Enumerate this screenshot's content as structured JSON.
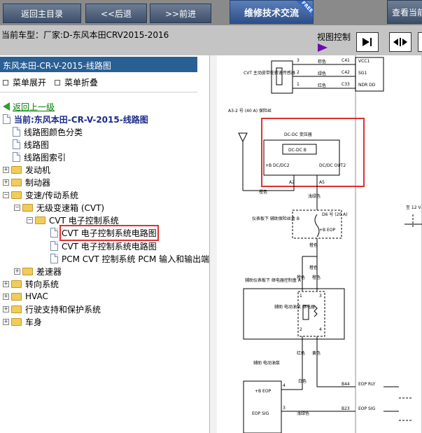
{
  "toolbar": {
    "home_label": "返回主目录",
    "back_label": "<<后退",
    "forward_label": ">>前进",
    "repair_label": "维修技术交流",
    "free_badge": "FREE",
    "view_current_label": "查看当前"
  },
  "infobar": {
    "current_model": "当前车型：厂家:D-东风本田CRV2015-2016",
    "view_control_label": "视图控制"
  },
  "tree": {
    "panel_title": "东风本田-CR-V-2015-线路图",
    "expand_label": "菜单展开",
    "collapse_label": "菜单折叠",
    "up_level": "返回上一级",
    "current": "当前:东风本田-CR-V-2015-线路图",
    "items": [
      "线路图颜色分类",
      "线路图",
      "线路图索引",
      "发动机",
      "制动器",
      "变速/传动系统",
      "无级变速箱 (CVT)",
      "CVT 电子控制系统",
      "CVT 电子控制系统电路图",
      "CVT 电子控制系统电路图",
      "PCM CVT 控制系统 PCM 输入和输出端",
      "差速器",
      "转向系统",
      "HVAC",
      "行驶支持和保护系统",
      "车身"
    ]
  },
  "diagram": {
    "labels": {
      "cvt_sensor": "CVT 主动皮带轮转速传感器",
      "pin3": "3",
      "pin2": "2",
      "pin1": "1",
      "c41": "C41",
      "c42": "C42",
      "c33": "C33",
      "wire_brown": "棕色",
      "wire_green": "绿色",
      "wire_red": "红色",
      "vcc1": "VCC1",
      "sg1": "SG1",
      "ndr_dd": "NDR DD",
      "fuse_a3": "A3-2 号 (40 A) 保险丝",
      "dcdc_title": "DC-DC 变压器",
      "dcdc_b": "DC-DC B",
      "b_dc2": "+B DC/DC2",
      "dc_out2": "DC/DC OUT2",
      "a2": "A2",
      "a5": "A5",
      "wire_orange": "橙色",
      "wire_lightgreen": "浅绿色",
      "under_dash_fuse": "仪表板下 辅助保险丝盒 B",
      "fuse_d6": "D6 号 (20 A)",
      "b_eop": "+B EOP",
      "to_12v": "至 12 V",
      "sub_relay_box": "辅助仪表板下 继电器控制盒 A",
      "relay_assist": "辅助 电动油泵 继电器",
      "pin_r1": "1",
      "pin_r3": "3",
      "pin_r2": "2",
      "pin_r4": "4",
      "wire_yellow": "黄色",
      "pump_label": "辅助 电动油泵",
      "b_eop2": "+B EOP",
      "eop_sig": "EOP SIG",
      "b44": "B44",
      "b23": "B23",
      "eop_rly": "EOP RLY",
      "eop_sig2": "EOP SIG",
      "wire_white": "白色",
      "pin_4": "4",
      "pin_3": "3"
    }
  },
  "colors": {
    "toolbar_bg": "#8a8a8a",
    "infobar_bg": "#c4c4c4",
    "title_bar": "#2a5f94",
    "highlight": "#e03030",
    "up_link": "#008000"
  }
}
